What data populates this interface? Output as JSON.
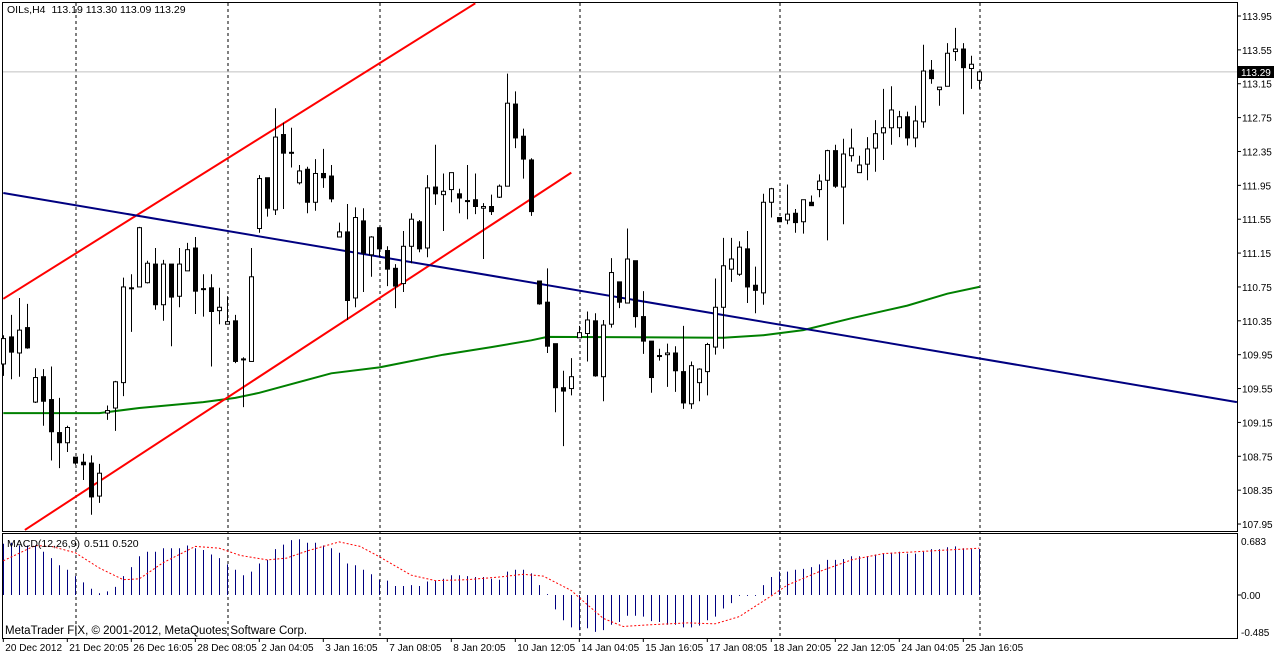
{
  "header": {
    "symbol": "OILs,H4",
    "ohlc": "113.19 113.30 113.09 113.29"
  },
  "macd_label": {
    "name": "MACD(12,26,9)",
    "values": "0.511 0.520"
  },
  "copyright": "MetaTrader FIX, © 2001-2012, MetaQuotes Software Corp.",
  "current_price_label": "113.29",
  "colors": {
    "up_fill": "#ffffff",
    "down_fill": "#000000",
    "channel": "#ff0000",
    "trendline": "#000080",
    "ma": "#008000",
    "macd_hist": "#000080",
    "macd_signal": "#ff0000",
    "price_line": "#c0c0c0",
    "separator": "#000000"
  },
  "chart_data": {
    "type": "candlestick",
    "title": "OILs,H4",
    "price_axis": {
      "min": 107.95,
      "max": 113.95,
      "ticks": [
        "113.95",
        "113.55",
        "113.15",
        "112.75",
        "112.35",
        "111.95",
        "111.55",
        "111.15",
        "110.75",
        "110.35",
        "109.95",
        "109.55",
        "109.15",
        "108.75",
        "108.35",
        "107.95"
      ]
    },
    "current_price": 113.29,
    "time_labels": [
      {
        "index": 0,
        "label": "20 Dec 2012"
      },
      {
        "index": 8,
        "label": "21 Dec 20:05"
      },
      {
        "index": 16,
        "label": "26 Dec 16:05"
      },
      {
        "index": 24,
        "label": "28 Dec 08:05"
      },
      {
        "index": 32,
        "label": "2 Jan 04:05"
      },
      {
        "index": 40,
        "label": "3 Jan 16:05"
      },
      {
        "index": 48,
        "label": "7 Jan 08:05"
      },
      {
        "index": 56,
        "label": "8 Jan 20:05"
      },
      {
        "index": 64,
        "label": "10 Jan 12:05"
      },
      {
        "index": 72,
        "label": "14 Jan 04:05"
      },
      {
        "index": 80,
        "label": "15 Jan 16:05"
      },
      {
        "index": 88,
        "label": "17 Jan 08:05"
      },
      {
        "index": 96,
        "label": "18 Jan 20:05"
      },
      {
        "index": 104,
        "label": "22 Jan 12:05"
      },
      {
        "index": 112,
        "label": "24 Jan 04:05"
      },
      {
        "index": 120,
        "label": "25 Jan 16:05"
      }
    ],
    "separator_indices": [
      9,
      28,
      47,
      72,
      97,
      122
    ],
    "candles_ohlc": [
      [
        109.84,
        110.18,
        109.7,
        110.14
      ],
      [
        110.16,
        110.42,
        109.66,
        109.98
      ],
      [
        109.97,
        110.62,
        109.69,
        110.24
      ],
      [
        110.27,
        110.55,
        110.02,
        110.03
      ],
      [
        109.39,
        109.79,
        109.38,
        109.68
      ],
      [
        109.69,
        109.78,
        109.11,
        109.4
      ],
      [
        109.42,
        109.81,
        108.7,
        109.04
      ],
      [
        109.03,
        109.44,
        108.61,
        108.91
      ],
      [
        108.91,
        109.11,
        108.8,
        109.09
      ],
      [
        108.74,
        108.74,
        108.65,
        108.67
      ],
      [
        108.68,
        108.78,
        108.47,
        108.65
      ],
      [
        108.67,
        108.76,
        108.06,
        108.27
      ],
      [
        108.28,
        108.66,
        108.2,
        108.55
      ],
      [
        109.26,
        109.35,
        109.18,
        109.29
      ],
      [
        109.32,
        109.64,
        109.05,
        109.63
      ],
      [
        109.62,
        110.86,
        109.46,
        110.75
      ],
      [
        110.74,
        110.9,
        110.22,
        110.74
      ],
      [
        110.75,
        111.46,
        110.75,
        111.45
      ],
      [
        110.8,
        111.06,
        110.79,
        111.03
      ],
      [
        111.02,
        111.21,
        110.48,
        110.54
      ],
      [
        110.54,
        111.07,
        110.35,
        111.02
      ],
      [
        111.02,
        111.02,
        110.05,
        110.63
      ],
      [
        110.64,
        111.21,
        110.51,
        111.02
      ],
      [
        110.94,
        111.27,
        110.94,
        111.19
      ],
      [
        111.21,
        111.34,
        110.43,
        110.7
      ],
      [
        110.73,
        110.9,
        110.4,
        110.73
      ],
      [
        110.74,
        110.9,
        109.81,
        110.46
      ],
      [
        110.47,
        110.74,
        110.31,
        110.51
      ],
      [
        110.31,
        110.64,
        110.31,
        110.34
      ],
      [
        110.35,
        110.42,
        109.85,
        109.87
      ],
      [
        109.9,
        109.92,
        109.33,
        109.9
      ],
      [
        109.87,
        111.21,
        109.87,
        110.87
      ],
      [
        111.44,
        112.07,
        111.39,
        112.03
      ],
      [
        112.04,
        112.04,
        111.58,
        111.68
      ],
      [
        111.66,
        112.86,
        111.6,
        112.52
      ],
      [
        112.55,
        112.69,
        111.67,
        112.33
      ],
      [
        112.34,
        112.63,
        112.16,
        112.34
      ],
      [
        111.98,
        112.19,
        111.96,
        112.12
      ],
      [
        112.14,
        112.17,
        111.62,
        111.75
      ],
      [
        111.75,
        112.26,
        111.65,
        112.09
      ],
      [
        112.09,
        112.38,
        111.92,
        112.04
      ],
      [
        112.06,
        112.19,
        111.75,
        111.79
      ],
      [
        111.34,
        111.51,
        111.34,
        111.4
      ],
      [
        111.4,
        111.73,
        110.36,
        110.59
      ],
      [
        110.62,
        111.69,
        110.51,
        111.57
      ],
      [
        111.53,
        111.68,
        110.69,
        111.15
      ],
      [
        111.13,
        111.35,
        110.87,
        111.34
      ],
      [
        111.45,
        111.46,
        111.1,
        111.2
      ],
      [
        111.18,
        111.23,
        110.76,
        110.96
      ],
      [
        110.97,
        111.02,
        110.5,
        110.76
      ],
      [
        110.79,
        111.41,
        110.69,
        111.23
      ],
      [
        111.23,
        111.62,
        111.03,
        111.55
      ],
      [
        111.52,
        111.54,
        111.16,
        111.2
      ],
      [
        111.21,
        112.07,
        111.1,
        111.92
      ],
      [
        111.93,
        112.43,
        111.72,
        111.85
      ],
      [
        111.84,
        112.09,
        111.41,
        111.88
      ],
      [
        111.9,
        112.1,
        111.75,
        112.1
      ],
      [
        111.85,
        111.91,
        111.62,
        111.8
      ],
      [
        111.77,
        112.19,
        111.55,
        111.77
      ],
      [
        111.78,
        112.09,
        111.61,
        111.7
      ],
      [
        111.68,
        111.74,
        111.08,
        111.7
      ],
      [
        111.7,
        111.84,
        111.6,
        111.64
      ],
      [
        111.81,
        111.96,
        111.8,
        111.94
      ],
      [
        111.94,
        113.27,
        111.94,
        112.92
      ],
      [
        112.91,
        113.06,
        112.39,
        112.51
      ],
      [
        112.53,
        112.62,
        112.03,
        112.26
      ],
      [
        112.25,
        112.27,
        111.59,
        111.64
      ],
      [
        110.82,
        110.82,
        110.54,
        110.55
      ],
      [
        110.57,
        110.97,
        109.97,
        110.05
      ],
      [
        110.08,
        110.08,
        109.27,
        109.56
      ],
      [
        109.56,
        109.76,
        108.87,
        109.52
      ],
      [
        109.55,
        109.91,
        109.47,
        109.69
      ],
      [
        110.15,
        110.29,
        110.15,
        110.21
      ],
      [
        110.2,
        110.46,
        109.87,
        110.36
      ],
      [
        110.35,
        110.44,
        109.69,
        109.7
      ],
      [
        109.69,
        110.36,
        109.4,
        110.3
      ],
      [
        110.31,
        111.09,
        110.27,
        110.92
      ],
      [
        110.81,
        110.81,
        110.5,
        110.57
      ],
      [
        110.56,
        111.44,
        110.56,
        111.08
      ],
      [
        111.06,
        111.06,
        110.27,
        110.4
      ],
      [
        110.4,
        110.7,
        109.96,
        110.11
      ],
      [
        110.11,
        110.11,
        109.5,
        109.68
      ],
      [
        109.94,
        110.02,
        109.88,
        109.94
      ],
      [
        109.95,
        110.08,
        109.57,
        109.97
      ],
      [
        109.97,
        110.05,
        109.51,
        109.76
      ],
      [
        109.75,
        110.29,
        109.31,
        109.38
      ],
      [
        109.37,
        109.87,
        109.31,
        109.82
      ],
      [
        109.62,
        109.79,
        109.4,
        109.78
      ],
      [
        109.75,
        110.09,
        109.47,
        110.07
      ],
      [
        110.04,
        110.85,
        109.95,
        110.51
      ],
      [
        110.51,
        111.33,
        110.02,
        111.0
      ],
      [
        110.96,
        111.33,
        110.81,
        111.08
      ],
      [
        110.9,
        111.29,
        110.88,
        111.22
      ],
      [
        111.2,
        111.41,
        110.56,
        110.75
      ],
      [
        110.77,
        110.99,
        110.44,
        110.71
      ],
      [
        110.68,
        111.85,
        110.54,
        111.75
      ],
      [
        111.75,
        111.92,
        111.57,
        111.91
      ],
      [
        111.57,
        111.57,
        111.52,
        111.52
      ],
      [
        111.54,
        111.96,
        111.49,
        111.61
      ],
      [
        111.62,
        111.67,
        111.39,
        111.51
      ],
      [
        111.52,
        111.78,
        111.38,
        111.78
      ],
      [
        111.75,
        111.83,
        111.71,
        111.71
      ],
      [
        111.9,
        112.08,
        111.81,
        112.0
      ],
      [
        112.01,
        112.37,
        111.3,
        112.36
      ],
      [
        112.36,
        112.43,
        111.92,
        111.94
      ],
      [
        111.93,
        112.5,
        111.49,
        112.32
      ],
      [
        112.3,
        112.62,
        112.23,
        112.39
      ],
      [
        112.1,
        112.3,
        112.1,
        112.19
      ],
      [
        112.2,
        112.52,
        112.01,
        112.38
      ],
      [
        112.39,
        112.72,
        112.11,
        112.56
      ],
      [
        112.57,
        113.09,
        112.25,
        112.63
      ],
      [
        112.63,
        113.12,
        112.43,
        112.84
      ],
      [
        112.63,
        112.83,
        112.52,
        112.76
      ],
      [
        112.76,
        112.82,
        112.42,
        112.51
      ],
      [
        112.51,
        112.89,
        112.4,
        112.71
      ],
      [
        112.7,
        113.61,
        112.63,
        113.3
      ],
      [
        113.31,
        113.43,
        113.15,
        113.21
      ],
      [
        113.08,
        113.11,
        112.89,
        113.11
      ],
      [
        113.12,
        113.63,
        113.12,
        113.51
      ],
      [
        113.53,
        113.81,
        113.42,
        113.56
      ],
      [
        113.56,
        113.63,
        112.79,
        113.34
      ],
      [
        113.33,
        113.48,
        113.09,
        113.38
      ],
      [
        113.19,
        113.3,
        113.09,
        113.29
      ]
    ],
    "moving_average": [
      [
        0,
        109.26
      ],
      [
        12,
        109.26
      ],
      [
        17,
        109.32
      ],
      [
        25,
        109.39
      ],
      [
        29,
        109.44
      ],
      [
        32,
        109.5
      ],
      [
        41,
        109.73
      ],
      [
        47,
        109.8
      ],
      [
        55,
        109.95
      ],
      [
        61,
        110.04
      ],
      [
        66,
        110.12
      ],
      [
        68,
        110.16
      ],
      [
        90,
        110.15
      ],
      [
        95,
        110.18
      ],
      [
        100,
        110.24
      ],
      [
        106,
        110.38
      ],
      [
        113,
        110.53
      ],
      [
        118,
        110.67
      ],
      [
        122,
        110.75
      ]
    ],
    "trendlines": [
      {
        "name": "channel-upper",
        "color": "#ff0000",
        "points": [
          [
            0,
            110.61
          ],
          [
            59,
            114.1
          ]
        ]
      },
      {
        "name": "channel-lower",
        "color": "#ff0000",
        "points": [
          [
            2.7,
            107.88
          ],
          [
            71,
            112.1
          ]
        ]
      },
      {
        "name": "descending-trendline",
        "color": "#000080",
        "points": [
          [
            0,
            111.86
          ],
          [
            154.2,
            109.39
          ]
        ]
      }
    ],
    "macd": {
      "range": [
        -0.485,
        0.683
      ],
      "ticks": [
        "0.683",
        "0.00",
        "-0.485"
      ],
      "histogram": [
        0.57,
        0.58,
        0.55,
        0.55,
        0.55,
        0.48,
        0.41,
        0.33,
        0.28,
        0.21,
        0.14,
        0.07,
        0.02,
        0.04,
        0.09,
        0.21,
        0.31,
        0.43,
        0.48,
        0.48,
        0.52,
        0.52,
        0.52,
        0.55,
        0.52,
        0.5,
        0.45,
        0.41,
        0.34,
        0.28,
        0.22,
        0.26,
        0.35,
        0.39,
        0.51,
        0.56,
        0.61,
        0.62,
        0.58,
        0.58,
        0.55,
        0.52,
        0.47,
        0.35,
        0.33,
        0.28,
        0.23,
        0.17,
        0.16,
        0.1,
        0.1,
        0.11,
        0.1,
        0.15,
        0.16,
        0.18,
        0.22,
        0.22,
        0.21,
        0.2,
        0.2,
        0.18,
        0.17,
        0.26,
        0.28,
        0.28,
        0.24,
        0.11,
        0.01,
        -0.16,
        -0.28,
        -0.36,
        -0.39,
        -0.37,
        -0.41,
        -0.39,
        -0.33,
        -0.3,
        -0.23,
        -0.23,
        -0.24,
        -0.29,
        -0.3,
        -0.33,
        -0.33,
        -0.36,
        -0.36,
        -0.34,
        -0.28,
        -0.24,
        -0.15,
        -0.09,
        -0.01,
        -0.01,
        -0.01,
        0.11,
        0.2,
        0.26,
        0.26,
        0.28,
        0.29,
        0.31,
        0.34,
        0.39,
        0.39,
        0.4,
        0.43,
        0.43,
        0.43,
        0.45,
        0.46,
        0.47,
        0.48,
        0.46,
        0.46,
        0.48,
        0.51,
        0.51,
        0.53,
        0.54,
        0.52,
        0.51,
        0.511
      ],
      "signal": [
        [
          0,
          0.38
        ],
        [
          4,
          0.55
        ],
        [
          6,
          0.54
        ],
        [
          9,
          0.47
        ],
        [
          12,
          0.3
        ],
        [
          15,
          0.17
        ],
        [
          17,
          0.18
        ],
        [
          20,
          0.36
        ],
        [
          24,
          0.54
        ],
        [
          27,
          0.52
        ],
        [
          29.6,
          0.44
        ],
        [
          33,
          0.39
        ],
        [
          35.4,
          0.41
        ],
        [
          38,
          0.49
        ],
        [
          42,
          0.59
        ],
        [
          44.6,
          0.54
        ],
        [
          46.7,
          0.44
        ],
        [
          51,
          0.22
        ],
        [
          54,
          0.16
        ],
        [
          58,
          0.17
        ],
        [
          62,
          0.2
        ],
        [
          65,
          0.23
        ],
        [
          67.5,
          0.21
        ],
        [
          71,
          0.05
        ],
        [
          72,
          -0.03
        ],
        [
          75,
          -0.26
        ],
        [
          77.5,
          -0.35
        ],
        [
          81,
          -0.33
        ],
        [
          85.5,
          -0.31
        ],
        [
          89,
          -0.32
        ],
        [
          92,
          -0.24
        ],
        [
          96,
          -0.01
        ],
        [
          98,
          0.11
        ],
        [
          102,
          0.26
        ],
        [
          106,
          0.39
        ],
        [
          110,
          0.46
        ],
        [
          114,
          0.48
        ],
        [
          122,
          0.52
        ]
      ]
    }
  }
}
